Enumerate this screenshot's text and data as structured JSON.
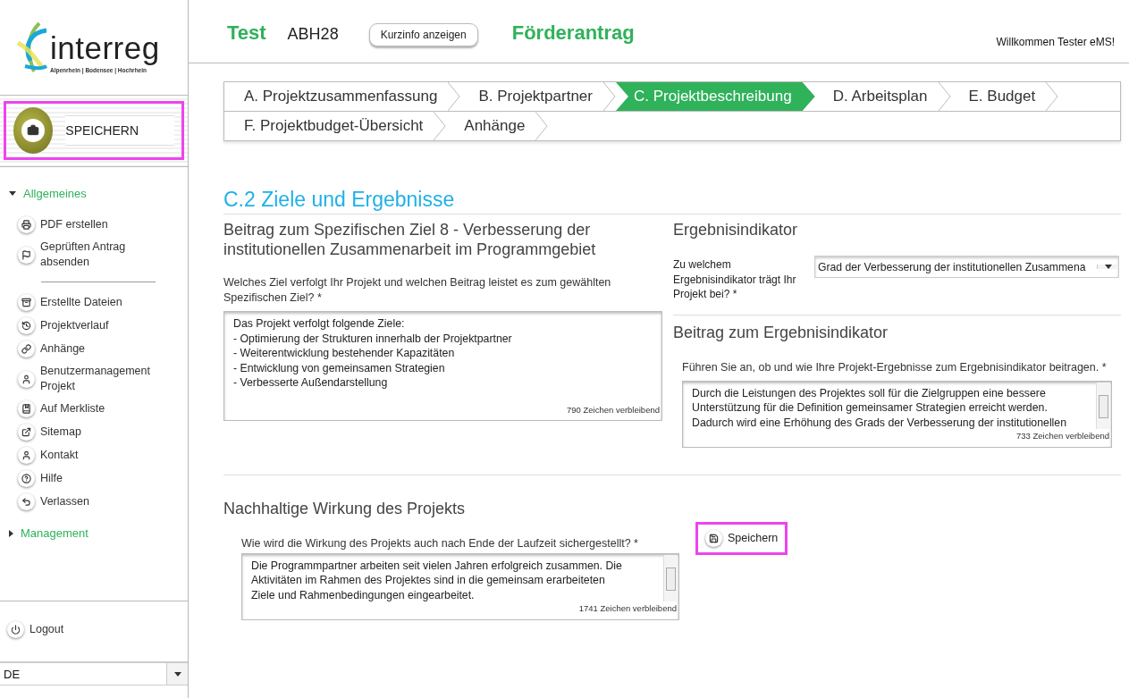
{
  "logo": {
    "name": "interreg",
    "tagline": "Alpenrhein | Bodensee | Hochrhein"
  },
  "header": {
    "project": "Test",
    "code": "ABH28",
    "info_button": "Kurzinfo anzeigen",
    "form_title": "Förderantrag",
    "welcome": "Willkommen Tester eMS!"
  },
  "save_panel": {
    "label": "SPEICHERN"
  },
  "sidebar": {
    "groups": [
      {
        "label": "Allgemeines",
        "expanded": true,
        "items": [
          {
            "label": "PDF erstellen"
          },
          {
            "label": "Geprüften Antrag absenden"
          },
          {
            "kind": "divider"
          },
          {
            "label": "Erstellte Dateien"
          },
          {
            "label": "Projektverlauf"
          },
          {
            "label": "Anhänge"
          },
          {
            "label": "Benutzermanagement Projekt"
          },
          {
            "label": "Auf Merkliste"
          },
          {
            "label": "Sitemap"
          },
          {
            "label": "Kontakt"
          },
          {
            "label": "Hilfe"
          },
          {
            "label": "Verlassen"
          }
        ]
      },
      {
        "label": "Management",
        "expanded": false
      }
    ],
    "logout": "Logout",
    "language": "DE"
  },
  "tabs": [
    {
      "label": "A. Projektzusammenfassung",
      "selected": false
    },
    {
      "label": "B. Projektpartner",
      "selected": false
    },
    {
      "label": "C. Projektbeschreibung",
      "selected": true
    },
    {
      "label": "D. Arbeitsplan",
      "selected": false
    },
    {
      "label": "E. Budget",
      "selected": false
    },
    {
      "label": "F. Projektbudget-Übersicht",
      "selected": false
    },
    {
      "label": "Anhänge",
      "selected": false
    }
  ],
  "section_title": "C.2 Ziele und Ergebnisse",
  "left": {
    "heading": "Beitrag zum Spezifischen Ziel 8 - Verbesserung der institutionellen Zusammenarbeit im Programmgebiet",
    "question": "Welches Ziel verfolgt Ihr Projekt und welchen Beitrag leistet es zum gewählten Spezifischen Ziel? *",
    "value": "Das Projekt verfolgt folgende Ziele:\n- Optimierung der Strukturen innerhalb der Projektpartner\n- Weiterentwicklung bestehender Kapazitäten\n- Entwicklung von gemeinsamen Strategien\n- Verbesserte Außendarstellung",
    "counter": "790 Zeichen verbleibend"
  },
  "right": {
    "heading": "Ergebnisindikator",
    "select_label": "Zu welchem Ergebnisindikator trägt Ihr Projekt bei? *",
    "select_value": "Grad der Verbesserung der institutionellen Zusammena",
    "heading2": "Beitrag zum Ergebnisindikator",
    "question": "Führen Sie an, ob und wie Ihre Projekt-Ergebnisse zum Ergebnisindikator beitragen. *",
    "value": "Durch die Leistungen des Projektes soll für die Zielgruppen eine bessere\nUnterstützung für die Definition gemeinsamer Strategien erreicht werden.\nDadurch wird eine Erhöhung des Grads der Verbesserung der institutionellen",
    "counter": "733 Zeichen verbleibend"
  },
  "bottom": {
    "heading": "Nachhaltige Wirkung des Projekts",
    "question": "Wie wird die Wirkung des Projekts auch nach Ende der Laufzeit sichergestellt? *",
    "value": "Die Programmpartner arbeiten seit vielen Jahren erfolgreich zusammen. Die\nAktivitäten im Rahmen des Projektes sind in die gemeinsam erarbeiteten\nZiele und Rahmenbedingungen eingearbeitet.",
    "counter": "1741 Zeichen verbleibend",
    "save_button": "Speichern"
  }
}
